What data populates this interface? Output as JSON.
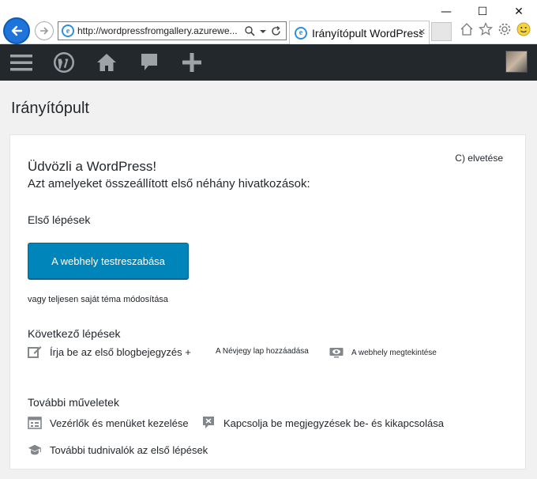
{
  "browser": {
    "url": "http://wordpressfromgallery.azurewe...",
    "tab_title": "Irányítópult WordPress",
    "minimize": "—",
    "maximize": "☐",
    "close": "✕",
    "tab_close": "✕"
  },
  "adminbar": {
    "icons": [
      "menu-icon",
      "wordpress-icon",
      "home-icon",
      "comment-icon",
      "plus-icon"
    ]
  },
  "page": {
    "title": "Irányítópult"
  },
  "welcome": {
    "dismiss": "C) elvetése",
    "heading": "Üdvözli a WordPress!",
    "subheading": "Azt amelyeket összeállított első néhány hivatkozások:",
    "first_steps": {
      "heading": "Első lépések",
      "button": "A webhely testreszabása",
      "alt_link": "vagy teljesen saját téma módosítása"
    },
    "next_steps": {
      "heading": "Következő lépések",
      "items": [
        {
          "label": "Írja be az első blogbejegyzés +",
          "icon": "edit-icon"
        },
        {
          "label": "A Névjegy lap hozzáadása",
          "icon": "plus-icon"
        },
        {
          "label": "A webhely megtekintése",
          "icon": "view-icon"
        }
      ]
    },
    "more_actions": {
      "heading": "További műveletek",
      "items": [
        {
          "label": "Vezérlők és menüket kezelése",
          "icon": "widgets-icon"
        },
        {
          "label": "Kapcsolja be megjegyzések be- és kikapcsolása",
          "icon": "comments-toggle-icon"
        },
        {
          "label": "További tudnivalók az első lépések",
          "icon": "learn-more-icon"
        }
      ]
    }
  },
  "colors": {
    "adminbar": "#23282d",
    "primary_button": "#0085ba",
    "page_bg": "#f1f1f1",
    "ie_blue": "#1e74d8"
  }
}
